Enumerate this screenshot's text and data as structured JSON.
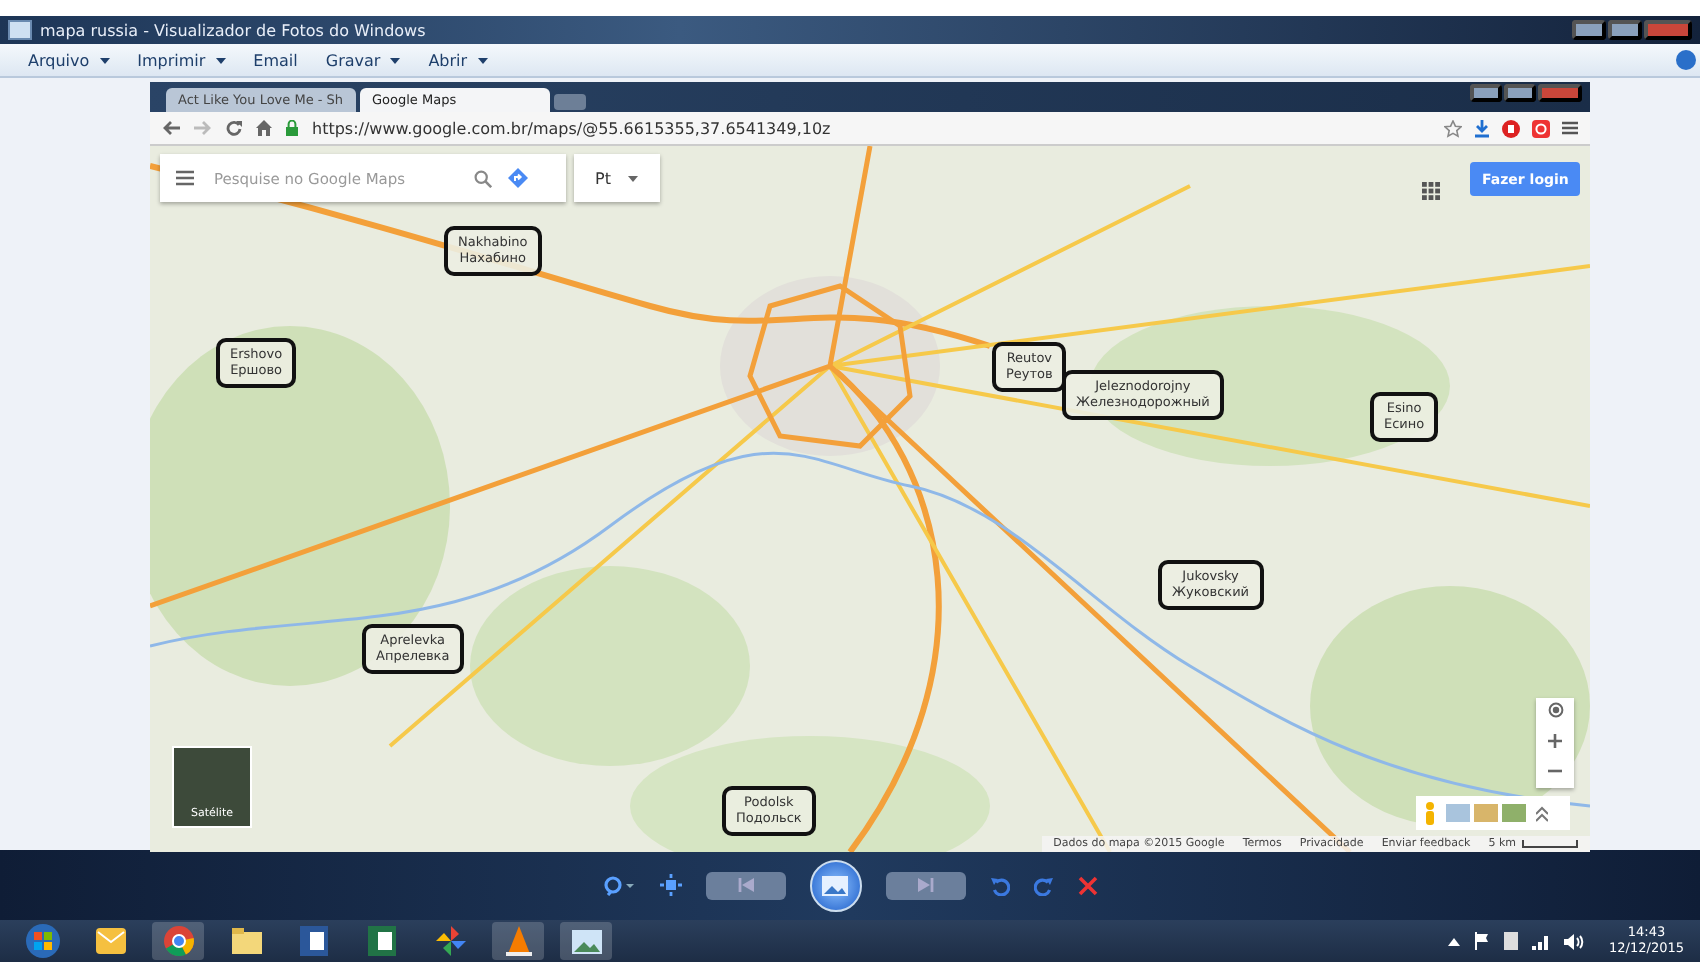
{
  "viewer": {
    "title": "mapa russia - Visualizador de Fotos do Windows",
    "menu": [
      {
        "label": "Arquivo",
        "has_menu": true
      },
      {
        "label": "Imprimir",
        "has_menu": true
      },
      {
        "label": "Email",
        "has_menu": false
      },
      {
        "label": "Gravar",
        "has_menu": true
      },
      {
        "label": "Abrir",
        "has_menu": true
      }
    ]
  },
  "browser": {
    "tabs": [
      {
        "title": "Act Like You Love Me - Sh",
        "selected": false
      },
      {
        "title": "Google Maps",
        "selected": true
      }
    ],
    "url": "https://www.google.com.br/maps/@55.6615355,37.6541349,10z"
  },
  "map": {
    "search": {
      "placeholder": "Pesquise no Google Maps"
    },
    "language": "Pt",
    "login_button": "Fazer login",
    "satellite_label": "Satélite",
    "annotations": [
      {
        "name": "Nakhabino",
        "name_cyrillic": "Нахабино"
      },
      {
        "name": "Ershovo",
        "name_cyrillic": "Ершово"
      },
      {
        "name": "Reutov",
        "name_cyrillic": "Реутов"
      },
      {
        "name": "Jeleznodorojny",
        "name_cyrillic": "Железнодорожный"
      },
      {
        "name": "Esino",
        "name_cyrillic": "Есино"
      },
      {
        "name": "Jukovsky",
        "name_cyrillic": "Жуковский"
      },
      {
        "name": "Aprelevka",
        "name_cyrillic": "Апрелевка"
      },
      {
        "name": "Podolsk",
        "name_cyrillic": "Подольск"
      }
    ],
    "footer": [
      "Dados do mapa ©2015 Google",
      "Termos",
      "Privacidade",
      "Enviar feedback"
    ],
    "scale": "5 km"
  },
  "taskbar": {
    "time": "14:43",
    "date": "12/12/2015"
  }
}
